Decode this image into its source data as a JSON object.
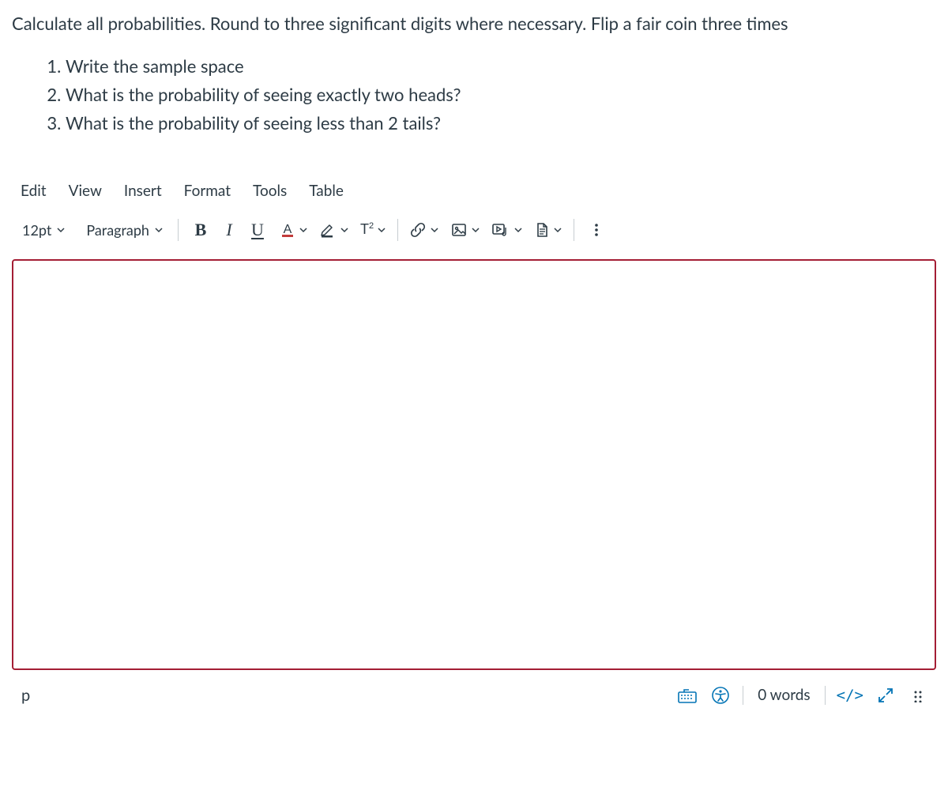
{
  "question": {
    "prompt": "Calculate all probabilities.  Round to three significant digits where necessary.  Flip a fair coin three times",
    "items": [
      "Write the sample space",
      "What is the probability of seeing exactly two heads?",
      "What is the probability of seeing less than 2 tails?"
    ]
  },
  "menubar": {
    "edit": "Edit",
    "view": "View",
    "insert": "Insert",
    "format": "Format",
    "tools": "Tools",
    "table": "Table"
  },
  "toolbar": {
    "fontsize": "12pt",
    "blocktype": "Paragraph",
    "bold": "B",
    "italic": "I",
    "underline": "U",
    "textcolor": "A",
    "super": "T²"
  },
  "statusbar": {
    "path": "p",
    "words": "0 words",
    "html": "</>"
  }
}
